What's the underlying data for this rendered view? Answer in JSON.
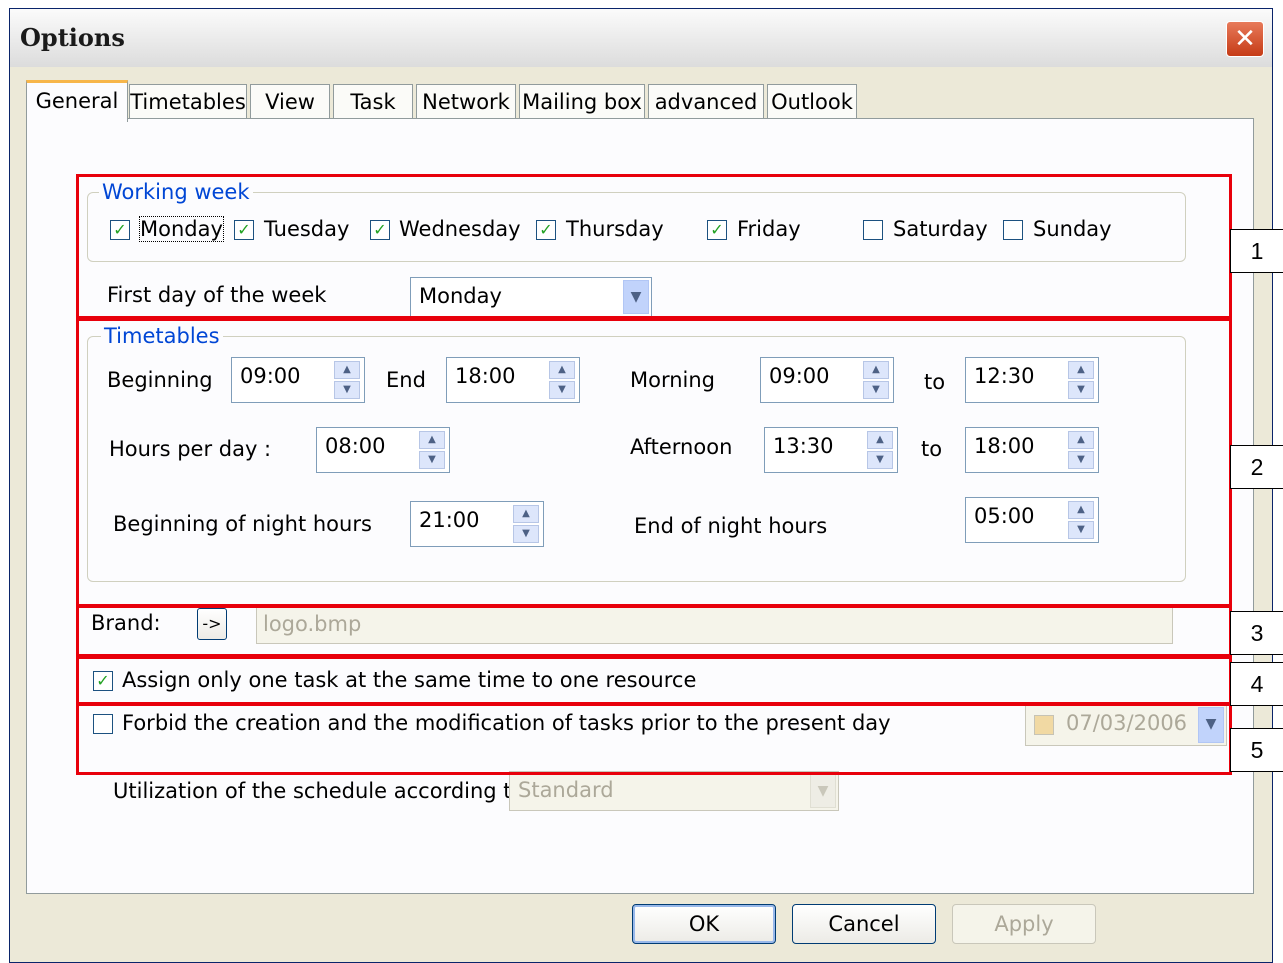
{
  "window": {
    "title": "Options",
    "close_label": "✕"
  },
  "tabs": [
    "General",
    "Timetables",
    "View",
    "Task",
    "Network",
    "Mailing box",
    "advanced",
    "Outlook"
  ],
  "working_week": {
    "group_label": "Working week",
    "days": [
      {
        "label": "Monday",
        "checked": true
      },
      {
        "label": "Tuesday",
        "checked": true
      },
      {
        "label": "Wednesday",
        "checked": true
      },
      {
        "label": "Thursday",
        "checked": true
      },
      {
        "label": "Friday",
        "checked": true
      },
      {
        "label": "Saturday",
        "checked": false
      },
      {
        "label": "Sunday",
        "checked": false
      }
    ],
    "first_day_label": "First day of the week",
    "first_day_value": "Monday"
  },
  "timetables": {
    "group_label": "Timetables",
    "beginning_label": "Beginning",
    "beginning_value": "09:00",
    "end_label": "End",
    "end_value": "18:00",
    "morning_label": "Morning",
    "morning_from": "09:00",
    "morning_to_label": "to",
    "morning_to": "12:30",
    "hours_per_day_label": "Hours per day :",
    "hours_per_day_value": "08:00",
    "afternoon_label": "Afternoon",
    "afternoon_from": "13:30",
    "afternoon_to_label": "to",
    "afternoon_to": "18:00",
    "night_begin_label": "Beginning of night hours",
    "night_begin_value": "21:00",
    "night_end_label": "End of night hours",
    "night_end_value": "05:00"
  },
  "brand": {
    "label": "Brand:",
    "button_label": "->",
    "value": "logo.bmp"
  },
  "assign_one_task": {
    "label": "Assign only one task at the same time to one resource",
    "checked": true
  },
  "forbid_past": {
    "label": "Forbid the creation and the modification of tasks prior to the present day",
    "checked": false,
    "date": "07/03/2006"
  },
  "schedule_utilization": {
    "label": "Utilization of the schedule according to",
    "value": "Standard"
  },
  "buttons": {
    "ok": "OK",
    "cancel": "Cancel",
    "apply": "Apply"
  },
  "callouts": [
    "1",
    "2",
    "3",
    "4",
    "5"
  ],
  "colors": {
    "annotation": "#e8000b",
    "group_label": "#0046d5",
    "check": "#21a121"
  }
}
